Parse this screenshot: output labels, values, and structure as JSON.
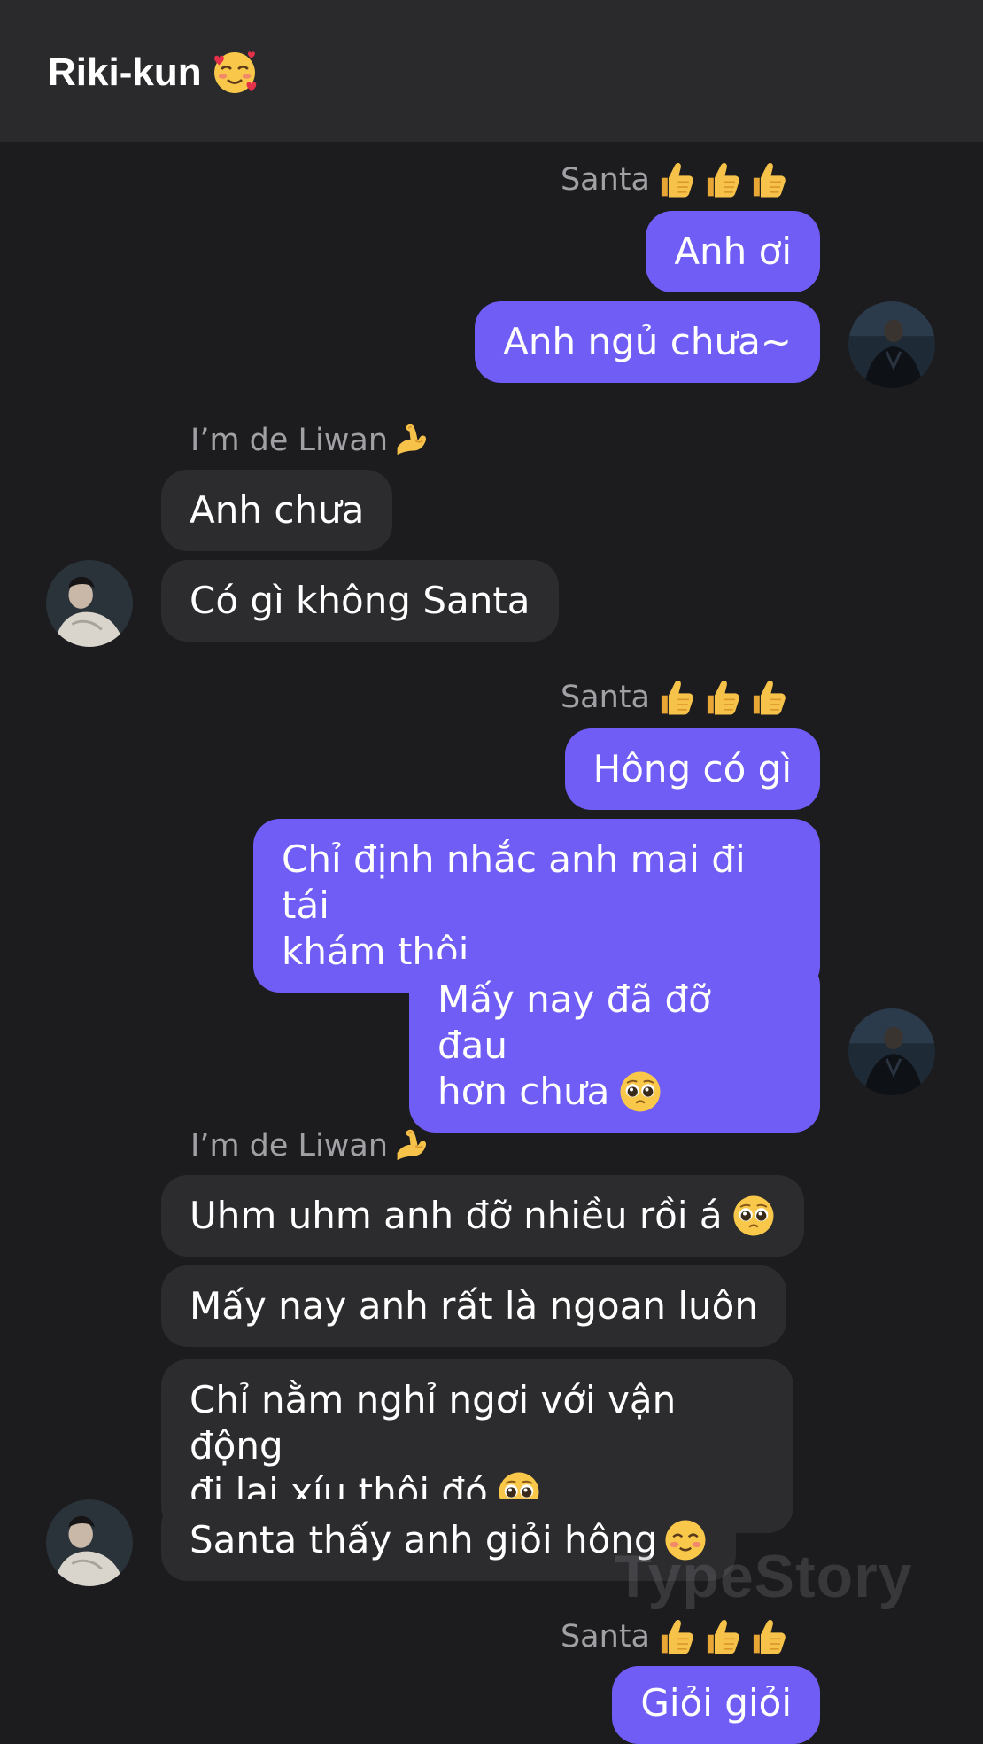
{
  "header": {
    "title": "Riki-kun",
    "title_emoji": "smiling-face-with-hearts-icon"
  },
  "senders": {
    "me": {
      "name": "Santa",
      "emoji": "thumbs-up-icon"
    },
    "other": {
      "name": "I’m de Liwan",
      "emoji": "flexed-biceps-icon"
    }
  },
  "messages": {
    "g1": [
      "Anh ơi",
      "Anh ngủ chưa~"
    ],
    "g2": [
      "Anh chưa",
      "Có gì không Santa"
    ],
    "g3": [
      "Hông có gì",
      "Chỉ định nhắc anh mai đi tái",
      "khám thôi",
      "Mấy nay đã đỡ đau",
      "hơn chưa"
    ],
    "g4": [
      "Uhm uhm anh đỡ nhiều rồi á",
      "Mấy nay anh rất là ngoan luôn",
      "Chỉ nằm nghỉ ngơi với vận động",
      "đi lại xíu thôi đó",
      "Santa thấy anh giỏi hông"
    ],
    "g5": [
      "Giỏi giỏi"
    ]
  },
  "watermark": "TypeStory",
  "colors": {
    "outgoing_bubble": "#6f5df6",
    "incoming_bubble": "#2c2c2e",
    "background": "#1c1c1e",
    "header": "#2a2a2c"
  }
}
